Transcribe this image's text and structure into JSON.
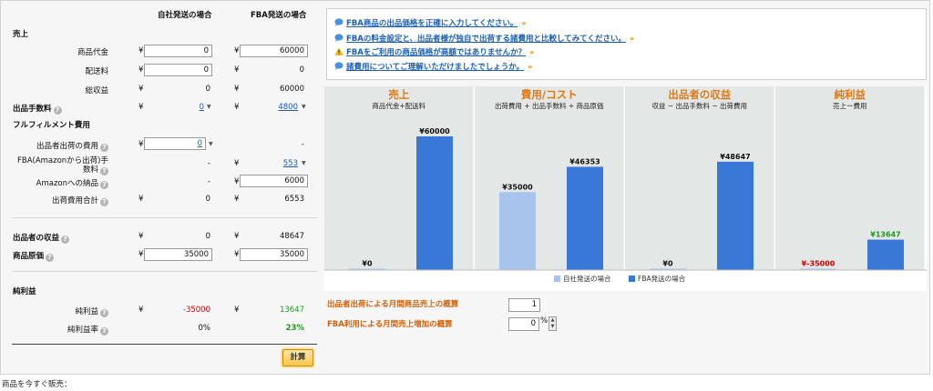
{
  "headers": {
    "self": "自社発送の場合",
    "fba": "FBA発送の場合"
  },
  "sections": {
    "sales": "売上",
    "fulfillment": "フルフィルメント費用",
    "net": "純利益"
  },
  "currency": "¥",
  "help_glyph": "?",
  "caret_glyph": "▼",
  "rows": {
    "product_price": {
      "label": "商品代金",
      "self": "0",
      "fba": "60000"
    },
    "shipping": {
      "label": "配送料",
      "self": "0",
      "fba": "0"
    },
    "gross": {
      "label": "総収益",
      "self": "0",
      "fba": "60000"
    },
    "sales_fee": {
      "label": "出品手数料",
      "self": "0",
      "fba": "4800"
    },
    "seller_ship": {
      "label": "出品者出荷の費用",
      "self": "0",
      "fba": "-"
    },
    "fba_fee": {
      "label_1": "FBA(Amazonから出荷)手",
      "label_2": "数料",
      "self": "-",
      "fba": "553"
    },
    "amazon_delivery": {
      "label": "Amazonへの納品",
      "self": "-",
      "fba": "6000"
    },
    "ship_total": {
      "label": "出荷費用合計",
      "self": "0",
      "fba": "6553"
    },
    "seller_revenue": {
      "label": "出品者の収益",
      "self": "0",
      "fba": "48647"
    },
    "cost": {
      "label": "商品原価",
      "self": "35000",
      "fba": "35000"
    },
    "net_profit": {
      "label": "純利益",
      "self": "-35000",
      "fba": "13647"
    },
    "net_margin": {
      "label": "純利益率",
      "self": "0%",
      "fba": "23%"
    }
  },
  "calc_button": "計算",
  "notices": [
    "FBA商品の出品価格を正確に入力してください。",
    "FBAの料金設定と、出品者様が独自で出荷する諸費用と比較してみてください。",
    "FBAをご利用の商品価格が高額ではありませんか？",
    "諸費用についてご理解いただけましたでしょうか。"
  ],
  "chev_glyph": "»",
  "chart_data": {
    "type": "bar",
    "groups": [
      {
        "title": "売上",
        "subtitle": "商品代金+配送料",
        "values": [
          0,
          60000
        ],
        "labels": [
          "¥0",
          "¥60000"
        ]
      },
      {
        "title": "費用/コスト",
        "subtitle": "出荷費用 + 出品手数料 + 商品原価",
        "values": [
          35000,
          46353
        ],
        "labels": [
          "¥35000",
          "¥46353"
        ]
      },
      {
        "title": "出品者の収益",
        "subtitle": "収益 − 出品手数料 − 出荷費用",
        "values": [
          0,
          48647
        ],
        "labels": [
          "¥0",
          "¥48647"
        ]
      },
      {
        "title": "純利益",
        "subtitle": "売上ー費用",
        "values": [
          -35000,
          13647
        ],
        "labels": [
          "¥-35000",
          "¥13647"
        ]
      }
    ],
    "series": [
      {
        "name": "自社発送の場合",
        "color": "#a6c4ec"
      },
      {
        "name": "FBA発送の場合",
        "color": "#3a78d8"
      }
    ],
    "ylim": [
      0,
      60000
    ]
  },
  "monthly": {
    "label_1": "出品者出荷による月間商品売上の概算",
    "value_1": "1",
    "label_2": "FBA利用による月間売上増加の概算",
    "value_2": "0",
    "unit_2": "%",
    "spin_up": "▲",
    "spin_down": "▼"
  },
  "footer_text": "商品を今すぐ販売："
}
